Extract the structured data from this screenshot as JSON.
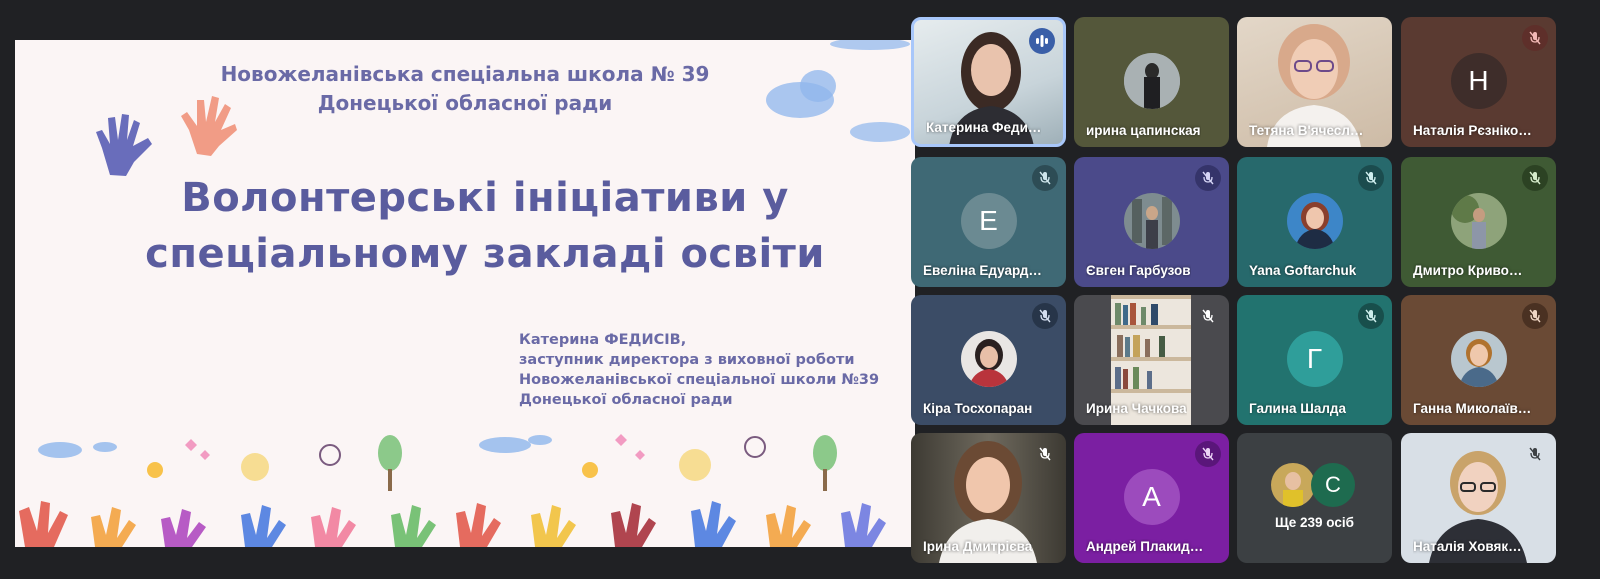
{
  "slide": {
    "school_line1": "Новожеланівська спеціальна школа № 39",
    "school_line2": "Донецької обласної ради",
    "title_line1": "Волонтерські ініціативи у",
    "title_line2": "спеціальному закладі освіти",
    "author_lines": [
      "Катерина ФЕДИСІВ,",
      "заступник директора з виховної роботи",
      "Новожеланівської спеціальної школи №39",
      "Донецької обласної ради"
    ]
  },
  "participants": [
    {
      "name": "Катерина Федисів",
      "display": "Катерина Феди…",
      "state": "speaking",
      "tile": "video"
    },
    {
      "name": "ирина цапинская",
      "display": "ирина цапинская",
      "state": "none",
      "tile": "photo"
    },
    {
      "name": "Тетяна В'ячеславівна",
      "display": "Тетяна В'ячесл…",
      "state": "none",
      "tile": "video"
    },
    {
      "name": "Наталія Рєзнікова",
      "display": "Наталія Рєзніко…",
      "state": "muted",
      "tile": "letter",
      "letter": "Н"
    },
    {
      "name": "Евеліна Едуардівна",
      "display": "Евеліна Едуард…",
      "state": "muted",
      "tile": "letter",
      "letter": "Е"
    },
    {
      "name": "Євген Гарбузов",
      "display": "Євген Гарбузов",
      "state": "muted",
      "tile": "photo"
    },
    {
      "name": "Yana Goftarchuk",
      "display": "Yana Goftarchuk",
      "state": "muted",
      "tile": "photo"
    },
    {
      "name": "Дмитро Кривошея",
      "display": "Дмитро Криво…",
      "state": "muted",
      "tile": "photo"
    },
    {
      "name": "Кіра Тосхопаран",
      "display": "Кіра Тосхопаран",
      "state": "muted",
      "tile": "photo"
    },
    {
      "name": "Ирина Чачкова",
      "display": "Ирина Чачкова",
      "state": "muted",
      "tile": "video"
    },
    {
      "name": "Галина Шалда",
      "display": "Галина Шалда",
      "state": "muted",
      "tile": "letter",
      "letter": "Г"
    },
    {
      "name": "Ганна Миколаївна",
      "display": "Ганна Миколаїв…",
      "state": "muted",
      "tile": "photo"
    },
    {
      "name": "Ірина Дмитрієва",
      "display": "Ірина Дмитрієва",
      "state": "muted",
      "tile": "video"
    },
    {
      "name": "Андрей Плакидин",
      "display": "Андрей Плакид…",
      "state": "muted",
      "tile": "letter",
      "letter": "А"
    },
    {
      "name": "more",
      "display": "Ще 239 осіб",
      "state": "none",
      "tile": "more",
      "letter": "С"
    },
    {
      "name": "Наталія Ховякова",
      "display": "Наталія Ховяк…",
      "state": "muted",
      "tile": "video"
    }
  ],
  "colors": {
    "background": "#202124",
    "speaking_border": "#a8c7fa",
    "slide_text": "#5a5c9e"
  }
}
